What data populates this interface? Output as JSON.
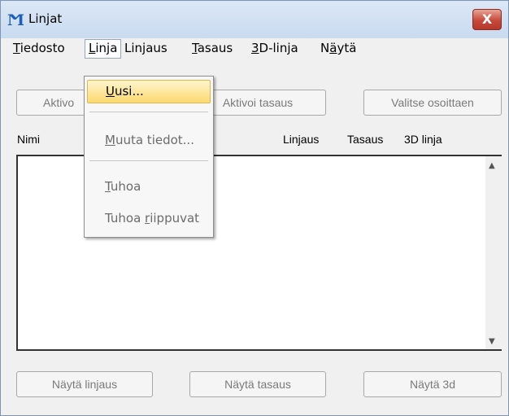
{
  "window": {
    "title": "Linjat",
    "close_label": "X",
    "app_icon": "linjat-app-icon",
    "accent": "#c7493a"
  },
  "menubar": {
    "items": [
      {
        "pre": "",
        "acc": "T",
        "post": "iedosto"
      },
      {
        "pre": "",
        "acc": "L",
        "post": "inja"
      },
      {
        "pre": "Lin",
        "acc": "j",
        "post": "aus"
      },
      {
        "pre": "",
        "acc": "T",
        "post": "asaus"
      },
      {
        "pre": "",
        "acc": "3",
        "post": "D-linja"
      },
      {
        "pre": "N",
        "acc": "ä",
        "post": "ytä"
      }
    ]
  },
  "toolbar": {
    "aktivoi_label": "Aktivo",
    "aktivoi_tasaus_label": "Aktivoi tasaus",
    "valitse_label": "Valitse osoittaen"
  },
  "columns": {
    "nimi": "Nimi",
    "linjaus": "Linjaus",
    "tasaus": "Tasaus",
    "linja3d": "3D linja"
  },
  "list": {
    "items": []
  },
  "dropdown": {
    "items": [
      {
        "acc": "U",
        "post": "usi...",
        "state": "highlighted"
      },
      {
        "pre": "",
        "acc": "M",
        "post": "uuta tiedot...",
        "state": "disabled"
      },
      {
        "pre": "",
        "acc": "T",
        "post": "uhoa",
        "state": "disabled"
      },
      {
        "pre": "Tuhoa ",
        "acc": "r",
        "post": "iippuvat",
        "state": "disabled"
      }
    ]
  },
  "bottom": {
    "nayta_linjaus": "Näytä linjaus",
    "nayta_tasaus": "Näytä tasaus",
    "nayta_3d": "Näytä 3d"
  }
}
